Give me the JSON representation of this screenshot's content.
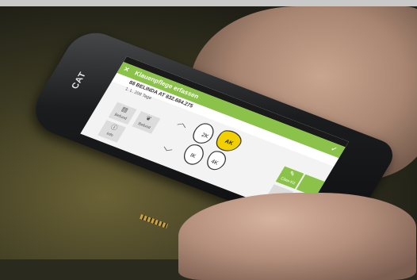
{
  "phone": {
    "brand": "CAT"
  },
  "screen": {
    "title": "Klauenpflege erfassen",
    "close_glyph": "✕",
    "check_glyph": "✓",
    "animal_line": "88 BELINDA AT 832.684.275",
    "sub_line": "1. L.   208 Tage",
    "tiles": [
      {
        "label": "Befund",
        "icon": "clipboard-icon"
      },
      {
        "label": "Befund",
        "icon": "leaf-icon"
      },
      {
        "label": "Info",
        "icon": "info-icon"
      },
      {
        "label": "Claw-Kit",
        "icon": "pencil-icon"
      }
    ],
    "claw": {
      "left_claw": "2K",
      "right_claw": "AK",
      "inner_left": "IK",
      "inner_right": "4K"
    },
    "colors": {
      "accent": "#8bc34a",
      "highlight": "#f2d000"
    }
  }
}
